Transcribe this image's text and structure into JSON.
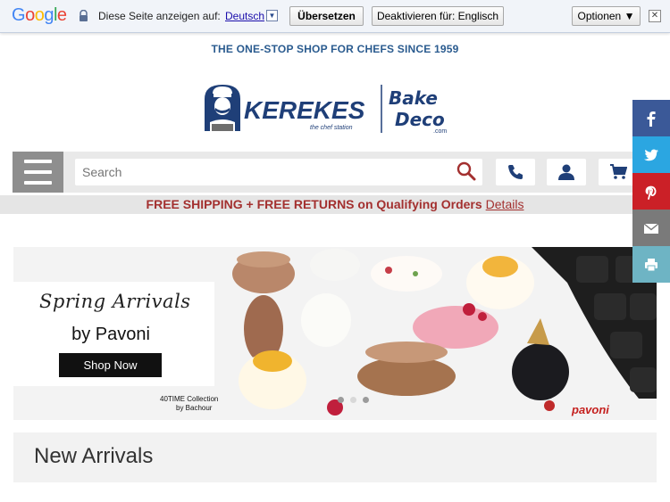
{
  "translate_bar": {
    "logo": [
      "G",
      "o",
      "o",
      "g",
      "l",
      "e"
    ],
    "prompt": "Diese Seite anzeigen auf:",
    "language": "Deutsch",
    "translate_button": "Übersetzen",
    "deactivate_button": "Deaktivieren für: Englisch",
    "options_button": "Optionen ▼"
  },
  "header": {
    "tagline": "THE ONE-STOP SHOP FOR CHEFS SINCE 1959",
    "brand": "KEREKES",
    "brand_sub": "the chef station",
    "partner_brand_line1": "Bake",
    "partner_brand_line2": "Deco",
    "partner_domain": ".com"
  },
  "search": {
    "placeholder": "Search"
  },
  "shipping_banner": {
    "text": "FREE SHIPPING + FREE RETURNS on Qualifying Orders",
    "details_link": "Details"
  },
  "hero": {
    "script_title": "Spring Arrivals",
    "subtitle": "by Pavoni",
    "cta": "Shop Now",
    "collection_line1": "40TIME Collection",
    "collection_line2": "by Bachour",
    "brand_mark": "pavoni"
  },
  "sections": {
    "new_arrivals": "New Arrivals"
  },
  "colors": {
    "navy": "#1f3f78",
    "accent_red": "#a3302f",
    "facebook": "#3b5998",
    "twitter": "#2ba6e1",
    "pinterest": "#cb2027",
    "email": "#7a7a7a",
    "print": "#6eb4c4"
  },
  "icons": [
    "shield-icon",
    "menu-icon",
    "search-icon",
    "phone-icon",
    "user-icon",
    "cart-icon",
    "facebook-icon",
    "twitter-icon",
    "pinterest-icon",
    "email-icon",
    "print-icon"
  ]
}
